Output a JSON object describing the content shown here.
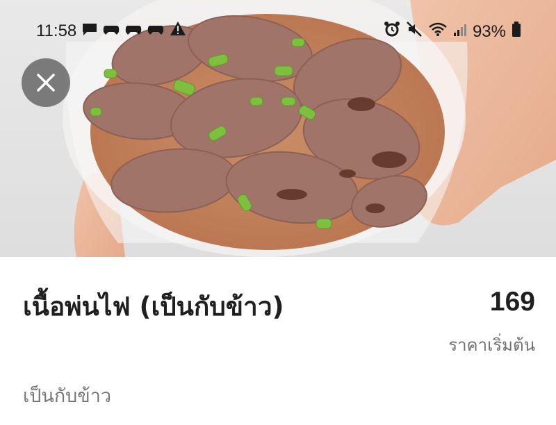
{
  "status_bar": {
    "time": "11:58",
    "battery": "93%",
    "left_icons": [
      "message-icon",
      "game-icon",
      "game-icon",
      "game-icon",
      "warning-icon"
    ],
    "right_icons": [
      "alarm-icon",
      "mute-icon",
      "wifi-icon",
      "signal-icon",
      "battery-icon"
    ]
  },
  "item": {
    "name": "เนื้อพ่นไฟ (เป็นกับข้าว)",
    "price": "169",
    "price_label": "ราคาเริ่มต้น",
    "description": "เป็นกับข้าว"
  },
  "colors": {
    "title": "#1f1f1f",
    "muted": "#767676",
    "close_button_bg": "#505050"
  }
}
